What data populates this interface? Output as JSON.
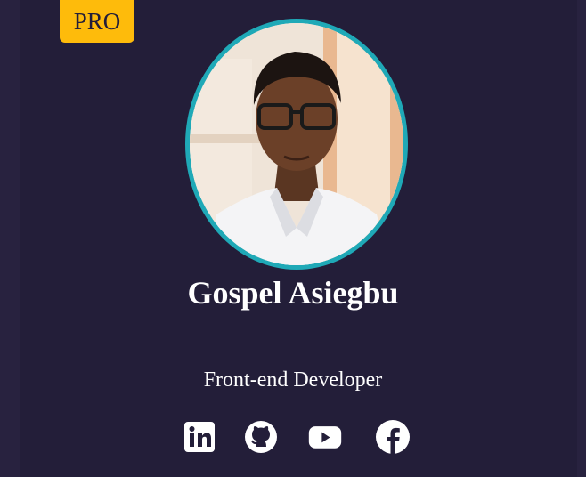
{
  "badge": {
    "label": "PRO"
  },
  "profile": {
    "name": "Gospel Asiegbu",
    "role": "Front-end Developer",
    "avatar_icon": "user-photo"
  },
  "social_links": [
    {
      "icon": "linkedin-icon"
    },
    {
      "icon": "github-icon"
    },
    {
      "icon": "youtube-icon"
    },
    {
      "icon": "facebook-icon"
    }
  ],
  "colors": {
    "background": "#231e39",
    "badge": "#febb0b",
    "avatar_border": "#1fa9b7",
    "text": "#ffffff"
  }
}
